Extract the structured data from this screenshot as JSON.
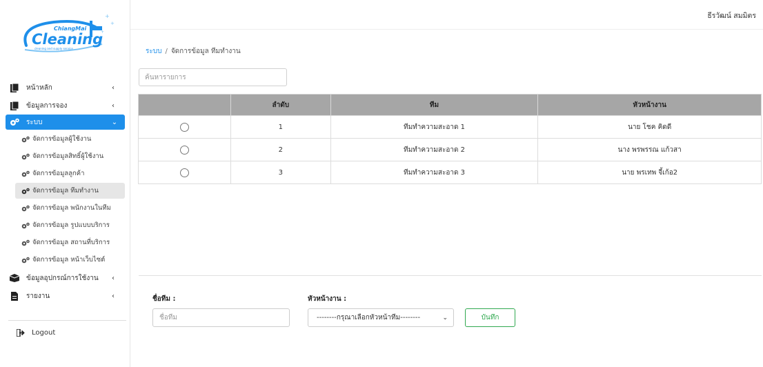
{
  "logo": {
    "top_text": "ChiangMai",
    "main_text": "Cleaning",
    "tagline": "cleaning and supply service"
  },
  "user": {
    "name": "ธีรวัฒน์ สมมิตร"
  },
  "sidebar": {
    "items": [
      {
        "label": "หน้าหลัก",
        "icon": "document-icon"
      },
      {
        "label": "ข้อมูลการจอง",
        "icon": "document-icon"
      },
      {
        "label": "ระบบ",
        "icon": "cogs-icon"
      }
    ],
    "system_submenu": [
      {
        "label": "จัดการข้อมูลผู้ใช้งาน"
      },
      {
        "label": "จัดการข้อมูลสิทธิ์ผู้ใช้งาน"
      },
      {
        "label": "จัดการข้อมูลลูกค้า"
      },
      {
        "label": "จัดการข้อมูล ทีมทำงาน"
      },
      {
        "label": "จัดการข้อมูล พนักงานในทีม"
      },
      {
        "label": "จัดการข้อมูล รูปแบบบริการ"
      },
      {
        "label": "จัดการข้อมูล สถานที่บริการ"
      },
      {
        "label": "จัดการข้อมูล หน้าเว็บไซต์"
      }
    ],
    "bottom_items": [
      {
        "label": "ข้อมูลอุปกรณ์การใช้งาน",
        "icon": "box-icon"
      },
      {
        "label": "รายงาน",
        "icon": "file-icon"
      }
    ],
    "logout_label": "Logout"
  },
  "breadcrumb": {
    "root": "ระบบ",
    "separator": "/",
    "current": "จัดการข้อมูล ทีมทำงาน"
  },
  "search": {
    "placeholder": "ค้นหารายการ"
  },
  "table": {
    "headers": [
      "",
      "ลำดับ",
      "ทีม",
      "หัวหน้างาน"
    ],
    "rows": [
      {
        "no": "1",
        "team": "ทีมทำความสะอาด 1",
        "leader": "นาย โชค คิดดี"
      },
      {
        "no": "2",
        "team": "ทีมทำความสะอาด 2",
        "leader": "นาง พรพรรณ แก้วสา"
      },
      {
        "no": "3",
        "team": "ทีมทำความสะอาด 3",
        "leader": "นาย พรเทพ จี้เก้อ2"
      }
    ]
  },
  "form": {
    "team_label": "ชื่อทีม :",
    "team_placeholder": "ชื่อทีม",
    "leader_label": "หัวหน้างาน :",
    "leader_selected": "--------กรุณาเลือกหัวหน้าทีม--------",
    "save_label": "บันทึก"
  },
  "colors": {
    "primary": "#1e8fea",
    "save": "#2fa84f",
    "table_header": "#a6a6a6",
    "active_sub": "#e6e6e6"
  }
}
